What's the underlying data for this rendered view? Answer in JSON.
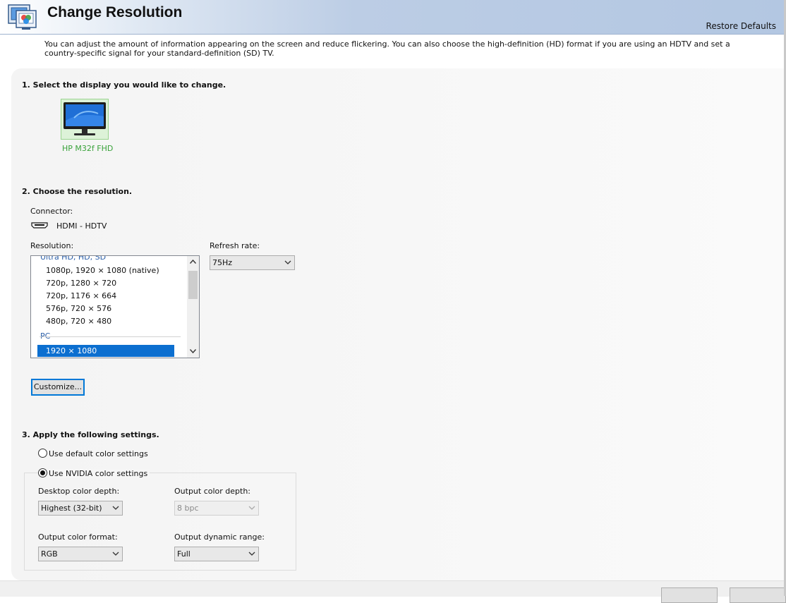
{
  "header": {
    "title": "Change Resolution",
    "restore_defaults": "Restore Defaults"
  },
  "description": "You can adjust the amount of information appearing on the screen and reduce flickering. You can also choose the high-definition (HD) format if you are using an HDTV and set a country-specific signal for your standard-definition (SD) TV.",
  "section1": {
    "heading": "1. Select the display you would like to change.",
    "display_name": "HP M32f FHD"
  },
  "section2": {
    "heading": "2. Choose the resolution.",
    "connector_label": "Connector:",
    "connector_value": "HDMI - HDTV",
    "resolution_label": "Resolution:",
    "resolution_groups": [
      "Ultra HD, HD, SD",
      "PC"
    ],
    "resolution_items": [
      "1080p, 1920 × 1080 (native)",
      "720p, 1280 × 720",
      "720p, 1176 × 664",
      "576p, 720 × 576",
      "480p, 720 × 480",
      "1920 × 1080"
    ],
    "selected_item": "1920 × 1080",
    "refresh_label": "Refresh rate:",
    "refresh_value": "75Hz",
    "customize_button": "Customize..."
  },
  "section3": {
    "heading": "3. Apply the following settings.",
    "radio_default": "Use default color settings",
    "radio_nvidia": "Use NVIDIA color settings",
    "selected_radio": "nvidia",
    "desktop_depth_label": "Desktop color depth:",
    "desktop_depth_value": "Highest (32-bit)",
    "output_depth_label": "Output color depth:",
    "output_depth_value": "8 bpc",
    "output_format_label": "Output color format:",
    "output_format_value": "RGB",
    "output_range_label": "Output dynamic range:",
    "output_range_value": "Full"
  },
  "colors": {
    "accent": "#0c6fd0",
    "display_label": "#39a23a",
    "group_label": "#2a5ea8"
  }
}
